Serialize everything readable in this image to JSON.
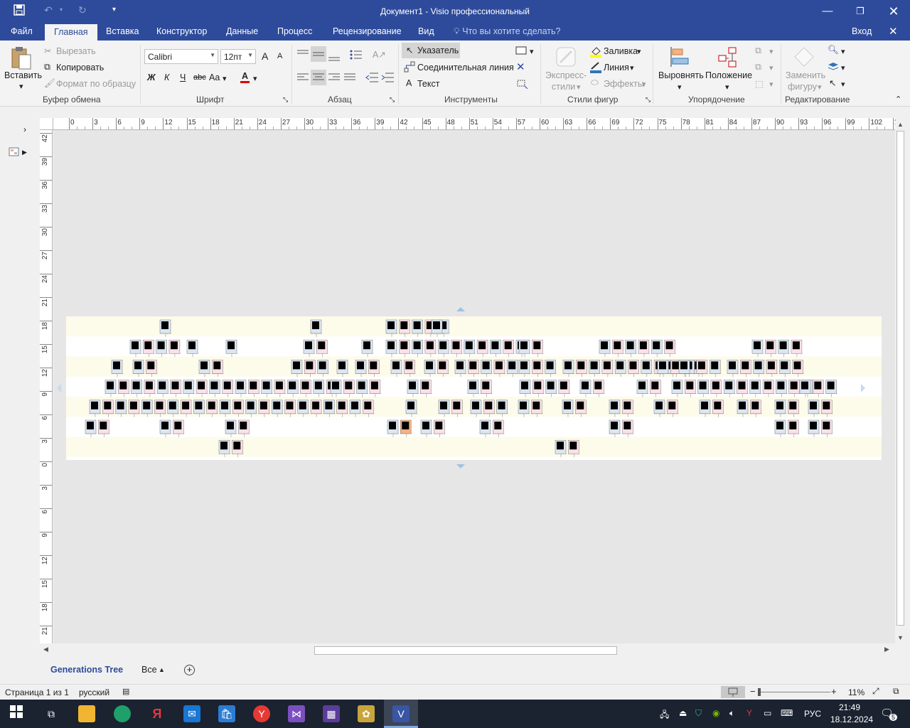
{
  "window": {
    "title": "Документ1 - Visio профессиональный"
  },
  "tabs": [
    "Файл",
    "Главная",
    "Вставка",
    "Конструктор",
    "Данные",
    "Процесс",
    "Рецензирование",
    "Вид"
  ],
  "tell_me": "Что вы хотите сделать?",
  "sign_in": "Вход",
  "ribbon": {
    "clipboard": {
      "paste": "Вставить",
      "cut": "Вырезать",
      "copy": "Копировать",
      "format_painter": "Формат по образцу",
      "group": "Буфер обмена"
    },
    "font": {
      "name": "Calibri",
      "size": "12пт",
      "bold": "Ж",
      "italic": "К",
      "underline": "Ч",
      "strike": "abc",
      "case": "Aa",
      "color": "A",
      "grow": "A",
      "shrink": "A",
      "group": "Шрифт"
    },
    "paragraph": {
      "group": "Абзац"
    },
    "tools": {
      "pointer": "Указатель",
      "connector": "Соединительная линия",
      "text": "Текст",
      "text_glyph": "A",
      "group": "Инструменты"
    },
    "shape_styles": {
      "quick_styles_1": "Экспресс-",
      "quick_styles_2": "стили",
      "fill": "Заливка",
      "line": "Линия",
      "effects": "Эффекты",
      "group": "Стили фигур"
    },
    "arrange": {
      "align": "Выровнять",
      "position": "Положение",
      "group": "Упорядочение"
    },
    "editing": {
      "change_shape_1": "Заменить",
      "change_shape_2": "фигуру",
      "group": "Редактирование"
    }
  },
  "hruler_labels": [
    "0",
    "3",
    "6",
    "9",
    "12",
    "15",
    "18",
    "21",
    "24",
    "27",
    "30",
    "33",
    "36",
    "39",
    "42",
    "45",
    "48",
    "51",
    "54",
    "57",
    "60",
    "63",
    "66",
    "69",
    "72",
    "75",
    "78",
    "81",
    "84",
    "87",
    "90",
    "93",
    "96",
    "99",
    "102",
    "10"
  ],
  "vruler_labels": [
    "42",
    "39",
    "36",
    "33",
    "30",
    "27",
    "24",
    "21",
    "18",
    "15",
    "12",
    "9",
    "6",
    "3",
    "0",
    "3",
    "6",
    "9",
    "12",
    "15",
    "18",
    "21"
  ],
  "page_tabs": {
    "active": "Generations Tree",
    "all": "Все"
  },
  "status": {
    "page": "Страница 1 из 1",
    "language": "русский",
    "zoom": "11%"
  },
  "taskbar": {
    "lang": "РУС",
    "time": "21:49",
    "date": "18.12.2024",
    "notif": "5"
  },
  "colors": {
    "title_blue": "#2e4b9b",
    "band": "#fdfbea",
    "person_blue": "#dce6f2",
    "person_pink": "#fbe1e7",
    "highlight": "#f4b183"
  }
}
